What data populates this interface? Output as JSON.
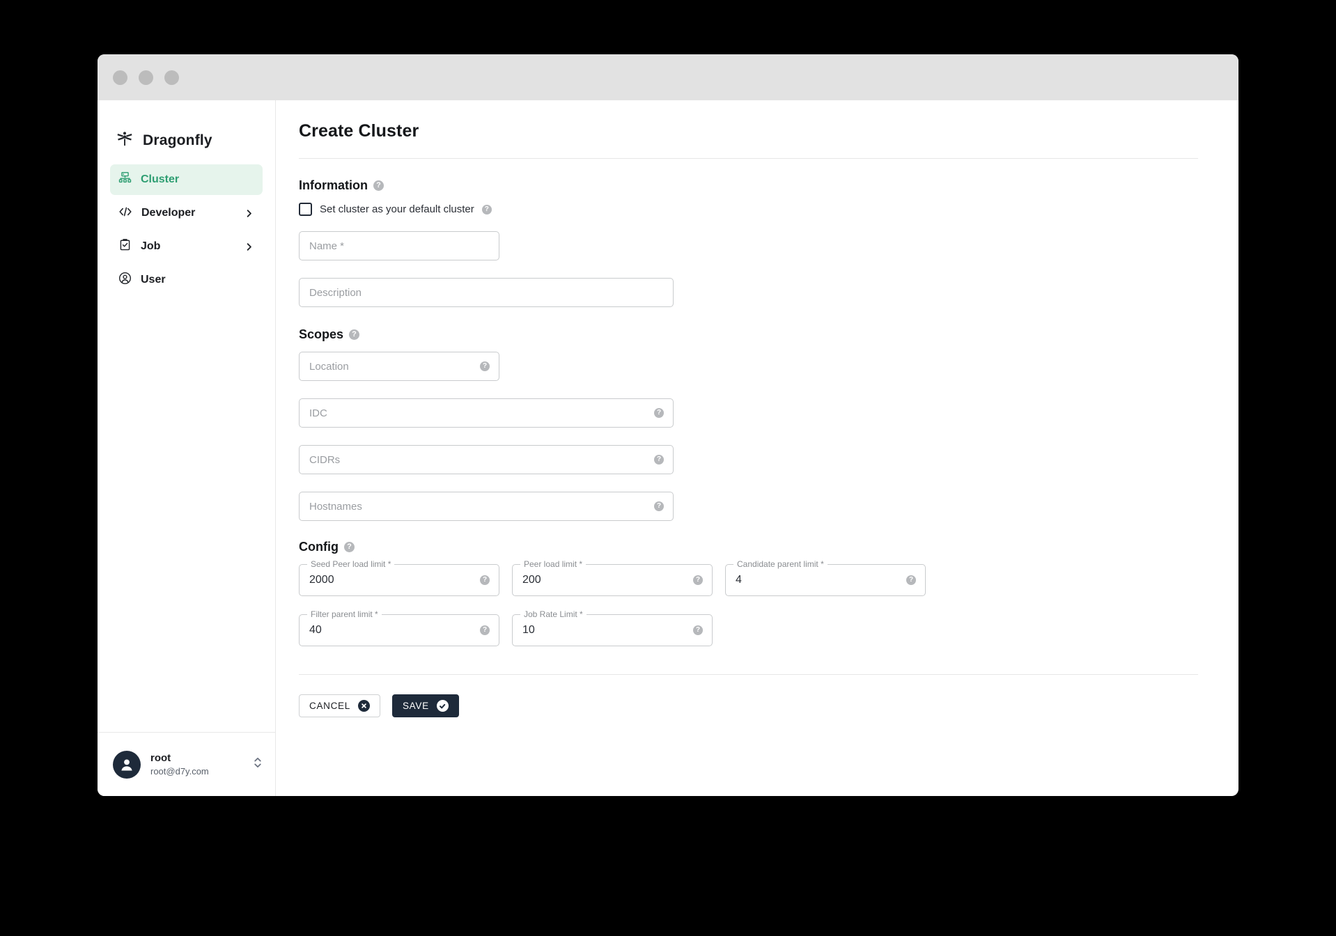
{
  "window": {
    "traffic_lights": [
      "close",
      "minimize",
      "maximize"
    ]
  },
  "sidebar": {
    "brand": {
      "name": "Dragonfly",
      "icon": "dragonfly-logo-icon"
    },
    "items": [
      {
        "label": "Cluster",
        "icon": "cluster-icon",
        "active": true,
        "expandable": false
      },
      {
        "label": "Developer",
        "icon": "code-icon",
        "active": false,
        "expandable": true
      },
      {
        "label": "Job",
        "icon": "clipboard-check-icon",
        "active": false,
        "expandable": true
      },
      {
        "label": "User",
        "icon": "user-circle-icon",
        "active": false,
        "expandable": false
      }
    ],
    "profile": {
      "name": "root",
      "email": "root@d7y.com",
      "avatar_icon": "avatar-person-icon",
      "selector_icon": "chevron-up-down-icon"
    }
  },
  "main": {
    "page_title": "Create Cluster",
    "sections": {
      "information": {
        "title": "Information",
        "help_icon": "help-circle-icon",
        "checkbox": {
          "label": "Set cluster as your default cluster",
          "checked": false,
          "help_icon": "help-circle-icon"
        },
        "fields": [
          {
            "placeholder": "Name *",
            "value": "",
            "width": "narrow",
            "help": false
          },
          {
            "placeholder": "Description",
            "value": "",
            "width": "wide",
            "help": false
          }
        ]
      },
      "scopes": {
        "title": "Scopes",
        "help_icon": "help-circle-icon",
        "fields": [
          {
            "placeholder": "Location",
            "value": "",
            "width": "narrow",
            "help": true
          },
          {
            "placeholder": "IDC",
            "value": "",
            "width": "wide",
            "help": true
          },
          {
            "placeholder": "CIDRs",
            "value": "",
            "width": "wide",
            "help": true
          },
          {
            "placeholder": "Hostnames",
            "value": "",
            "width": "wide",
            "help": true
          }
        ]
      },
      "config": {
        "title": "Config",
        "help_icon": "help-circle-icon",
        "rows": [
          [
            {
              "label": "Seed Peer load limit *",
              "value": "2000"
            },
            {
              "label": "Peer load limit *",
              "value": "200"
            },
            {
              "label": "Candidate parent limit *",
              "value": "4"
            }
          ],
          [
            {
              "label": "Filter parent limit *",
              "value": "40"
            },
            {
              "label": "Job Rate Limit *",
              "value": "10"
            }
          ]
        ]
      }
    },
    "actions": {
      "cancel_label": "CANCEL",
      "cancel_icon": "close-circle-icon",
      "save_label": "SAVE",
      "save_icon": "check-circle-icon"
    }
  },
  "colors": {
    "accent_green": "#2e9e72",
    "accent_green_bg": "#e6f4ec",
    "dark_navy": "#1e2a3a",
    "titlebar": "#e2e2e2",
    "border": "#c9cbcd",
    "help_gray": "#b6b8bb"
  }
}
